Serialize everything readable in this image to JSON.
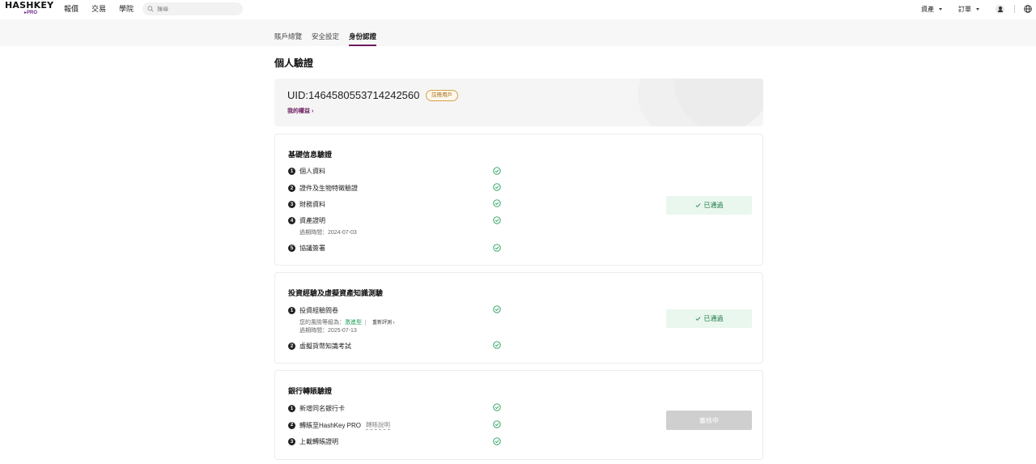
{
  "logo": {
    "main": "HASHKEY",
    "sub": "PRO"
  },
  "nav": {
    "items": [
      "報價",
      "交易",
      "學院"
    ]
  },
  "search": {
    "placeholder": "搜尋"
  },
  "right_nav": {
    "assets": "資產",
    "orders": "訂單"
  },
  "subnav": {
    "tabs": [
      "賬戶總覽",
      "安全設定",
      "身份認證"
    ],
    "active_index": 2
  },
  "page": {
    "title": "個人驗證"
  },
  "uid_card": {
    "uid": "UID:1464580553714242560",
    "badge": "註冊用戶",
    "rights": "我的權益 ›"
  },
  "basic": {
    "title": "基礎信息驗證",
    "steps": [
      {
        "num": "1",
        "label": "個人資料"
      },
      {
        "num": "2",
        "label": "證件及生物特徵驗證"
      },
      {
        "num": "3",
        "label": "財務資料"
      },
      {
        "num": "4",
        "label": "資產證明",
        "expiry": "過期時間：2024-07-03"
      },
      {
        "num": "5",
        "label": "協議簽署"
      }
    ],
    "status": "已通過"
  },
  "invest": {
    "title": "投資經驗及虛擬資產知識測驗",
    "steps": [
      {
        "num": "1",
        "label": "投資經驗問卷",
        "risk_prefix": "您的風險等級為：",
        "risk_level": "激進型",
        "retake": "重新評測 ›",
        "expiry": "過期時間：2025-07-13"
      },
      {
        "num": "2",
        "label": "虛擬貨幣知識考試"
      }
    ],
    "status": "已通過"
  },
  "bank": {
    "title": "銀行轉賬驗證",
    "steps": [
      {
        "num": "1",
        "label": "新增同名銀行卡"
      },
      {
        "num": "2",
        "label": "轉賬至HashKey PRO",
        "help": "轉賬說明"
      },
      {
        "num": "3",
        "label": "上載轉賬證明"
      }
    ],
    "status": "審核中"
  }
}
